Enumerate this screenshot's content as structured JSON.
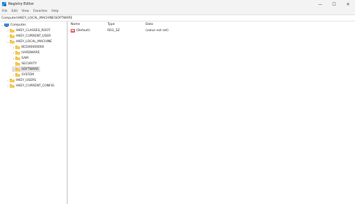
{
  "window": {
    "title": "Registry Editor",
    "controls": {
      "minimize": "—",
      "maximize": "☐",
      "close": "✕"
    }
  },
  "menu": [
    "File",
    "Edit",
    "View",
    "Favorites",
    "Help"
  ],
  "address": "Computer\\HKEY_LOCAL_MACHINE\\SOFTWARE",
  "tree": {
    "root": "Computer",
    "items": [
      {
        "label": "HKEY_CLASSES_ROOT",
        "chev": "›"
      },
      {
        "label": "HKEY_CURRENT_USER",
        "chev": "›"
      },
      {
        "label": "HKEY_LOCAL_MACHINE",
        "chev": "⌄"
      },
      {
        "label": "BCD00000000",
        "chev": "›"
      },
      {
        "label": "HARDWARE",
        "chev": "›"
      },
      {
        "label": "SAM",
        "chev": "›"
      },
      {
        "label": "SECURITY",
        "chev": ""
      },
      {
        "label": "SOFTWARE",
        "chev": "›"
      },
      {
        "label": "SYSTEM",
        "chev": "›"
      },
      {
        "label": "HKEY_USERS",
        "chev": "›"
      },
      {
        "label": "HKEY_CURRENT_CONFIG",
        "chev": "›"
      }
    ],
    "root_chev": "⌄"
  },
  "values": {
    "headers": {
      "name": "Name",
      "type": "Type",
      "data": "Data"
    },
    "rows": [
      {
        "icon": "ab",
        "name": "(Default)",
        "type": "REG_SZ",
        "data": "(value not set)"
      }
    ]
  }
}
